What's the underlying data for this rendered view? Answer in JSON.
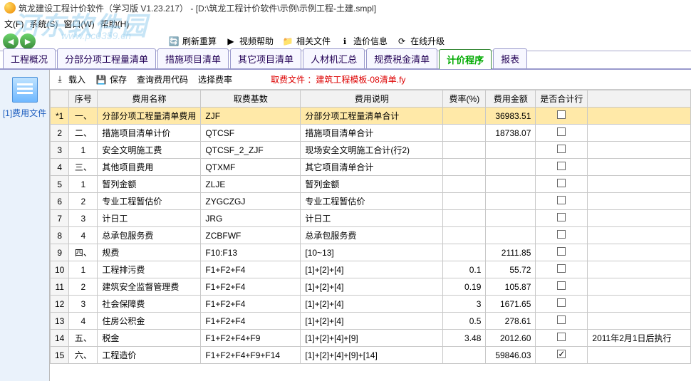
{
  "title": "筑龙建设工程计价软件（学习版  V1.23.217）  -  [D:\\筑龙工程计价软件\\示例\\示例工程-土建.smpl]",
  "menubar": [
    "文(F)",
    "系统(S)",
    "窗口(W)",
    "帮助(H)"
  ],
  "watermark": "河东软件园",
  "watermark_sub": "www.pc0359.cn",
  "toolbar1": {
    "refresh": "刷新重算",
    "video": "视频帮助",
    "related": "相关文件",
    "cost": "造价信息",
    "upgrade": "在线升级"
  },
  "tabs": [
    "工程概况",
    "分部分项工程量清单",
    "措施项目清单",
    "其它项目清单",
    "人材机汇总",
    "规费税金清单",
    "计价程序",
    "报表"
  ],
  "active_tab": 6,
  "left_file": "[1]费用文件",
  "toolbar2": {
    "import": "载入",
    "save": "保存",
    "query": "查询费用代码",
    "pick": "选择费率",
    "fee_file_label": "取费文件 ：",
    "fee_file_name": "建筑工程模板-08清单.fy"
  },
  "columns": [
    "",
    "序号",
    "费用名称",
    "取费基数",
    "费用说明",
    "费率(%)",
    "费用金额",
    "是否合计行",
    ""
  ],
  "rows": [
    {
      "n": "*1",
      "sel": true,
      "seq": "一、",
      "name": "分部分项工程量清单费用",
      "base": "ZJF",
      "desc": "分部分项工程量清单合计",
      "rate": "",
      "amt": "36983.51",
      "chk": false,
      "note": ""
    },
    {
      "n": "2",
      "seq": "二、",
      "name": "措施项目清单计价",
      "base": "QTCSF",
      "desc": "措施项目清单合计",
      "rate": "",
      "amt": "18738.07",
      "chk": false,
      "note": ""
    },
    {
      "n": "3",
      "seq": "1",
      "name": "安全文明施工费",
      "base": "QTCSF_2_ZJF",
      "desc": "现场安全文明施工合计(行2)",
      "rate": "",
      "amt": "",
      "chk": false,
      "note": ""
    },
    {
      "n": "4",
      "seq": "三、",
      "name": "其他项目费用",
      "base": "QTXMF",
      "desc": "其它项目清单合计",
      "rate": "",
      "amt": "",
      "chk": false,
      "note": ""
    },
    {
      "n": "5",
      "seq": "1",
      "name": "暂列金额",
      "base": "ZLJE",
      "desc": "暂列金额",
      "rate": "",
      "amt": "",
      "chk": false,
      "note": ""
    },
    {
      "n": "6",
      "seq": "2",
      "name": "专业工程暂估价",
      "base": "ZYGCZGJ",
      "desc": "专业工程暂估价",
      "rate": "",
      "amt": "",
      "chk": false,
      "note": ""
    },
    {
      "n": "7",
      "seq": "3",
      "name": "计日工",
      "base": "JRG",
      "desc": "计日工",
      "rate": "",
      "amt": "",
      "chk": false,
      "note": ""
    },
    {
      "n": "8",
      "seq": "4",
      "name": "总承包服务费",
      "base": "ZCBFWF",
      "desc": "总承包服务费",
      "rate": "",
      "amt": "",
      "chk": false,
      "note": ""
    },
    {
      "n": "9",
      "seq": "四、",
      "name": "规费",
      "base": "F10:F13",
      "desc": "[10~13]",
      "rate": "",
      "amt": "2111.85",
      "chk": false,
      "note": ""
    },
    {
      "n": "10",
      "seq": "1",
      "name": "工程排污费",
      "base": "F1+F2+F4",
      "desc": "[1]+[2]+[4]",
      "rate": "0.1",
      "amt": "55.72",
      "chk": false,
      "note": ""
    },
    {
      "n": "11",
      "seq": "2",
      "name": "建筑安全监督管理费",
      "base": "F1+F2+F4",
      "desc": "[1]+[2]+[4]",
      "rate": "0.19",
      "amt": "105.87",
      "chk": false,
      "note": ""
    },
    {
      "n": "12",
      "seq": "3",
      "name": "社会保障费",
      "base": "F1+F2+F4",
      "desc": "[1]+[2]+[4]",
      "rate": "3",
      "amt": "1671.65",
      "chk": false,
      "note": ""
    },
    {
      "n": "13",
      "seq": "4",
      "name": "住房公积金",
      "base": "F1+F2+F4",
      "desc": "[1]+[2]+[4]",
      "rate": "0.5",
      "amt": "278.61",
      "chk": false,
      "note": ""
    },
    {
      "n": "14",
      "seq": "五、",
      "name": "税金",
      "base": "F1+F2+F4+F9",
      "desc": "[1]+[2]+[4]+[9]",
      "rate": "3.48",
      "amt": "2012.60",
      "chk": false,
      "note": "2011年2月1日后执行"
    },
    {
      "n": "15",
      "seq": "六、",
      "name": "工程造价",
      "base": "F1+F2+F4+F9+F14",
      "desc": "[1]+[2]+[4]+[9]+[14]",
      "rate": "",
      "amt": "59846.03",
      "chk": true,
      "note": ""
    }
  ]
}
